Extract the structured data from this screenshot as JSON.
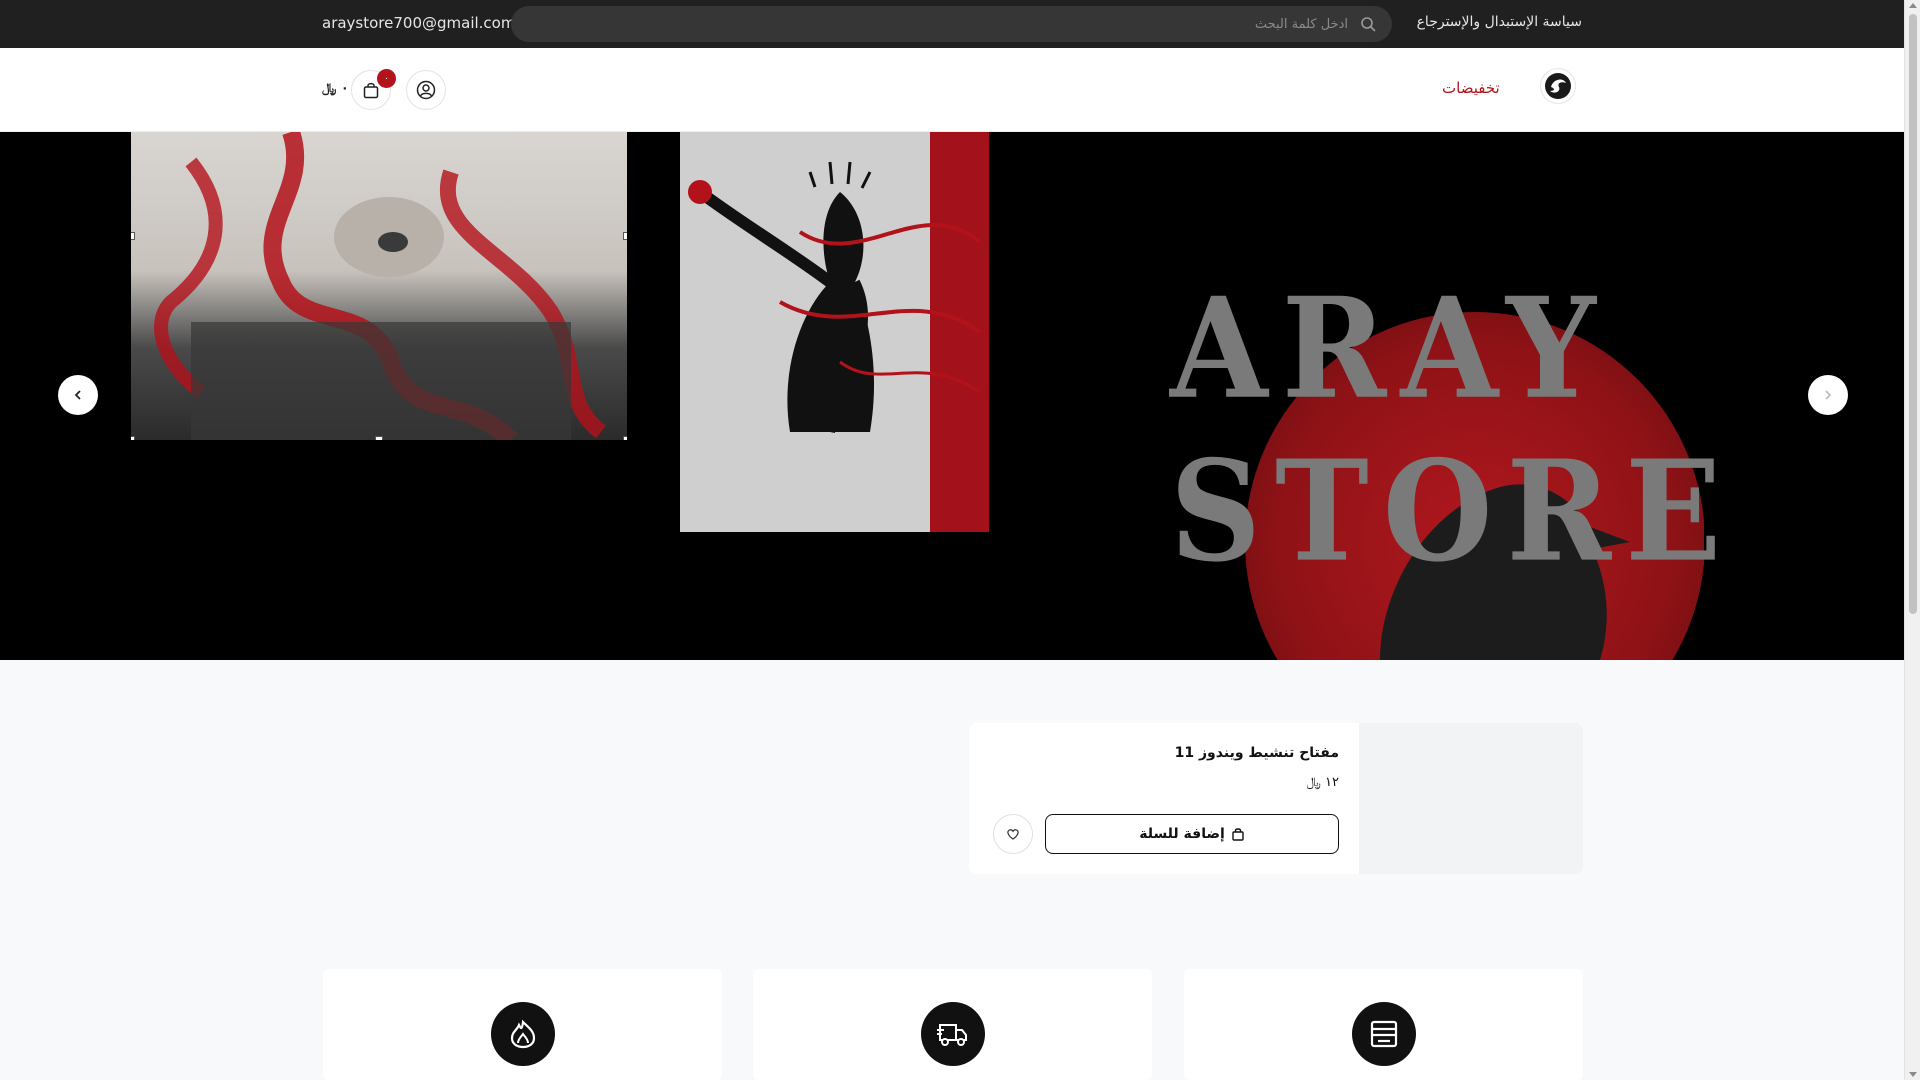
{
  "topbar": {
    "email": "araystore700@gmail.com",
    "search_placeholder": "ادخل كلمة البحث",
    "policy_link": "سياسة الإستبدال والإسترجاع"
  },
  "header": {
    "nav_sale": "تخفيضات",
    "cart_count": "٠",
    "cart_total": "٠ ﷼"
  },
  "hero": {
    "brand_line1": "ARAY",
    "brand_line2": "STORE"
  },
  "product": {
    "name": "مفتاح تنشيط ويندوز 11",
    "price": "١٢ ﷼",
    "add_to_cart": "إضافة للسلة"
  },
  "features": [
    {
      "icon": "store-icon"
    },
    {
      "icon": "delivery-truck-icon"
    },
    {
      "icon": "flame-icon"
    }
  ],
  "colors": {
    "topbar_bg": "#202020",
    "accent_red": "#b3141b",
    "hero_bg": "#000000"
  }
}
